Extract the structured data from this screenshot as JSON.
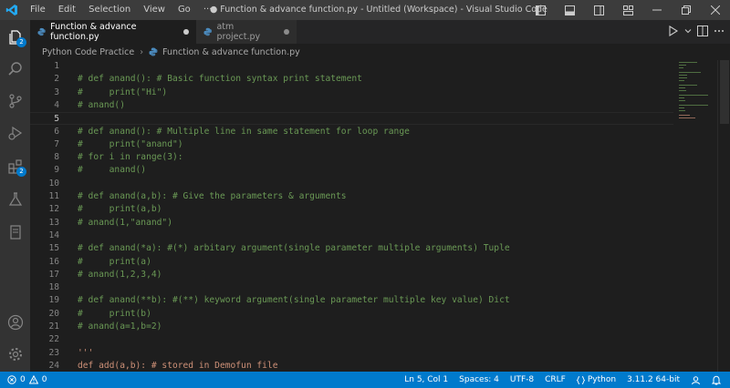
{
  "window": {
    "title": "● Function & advance function.py - Untitled (Workspace) - Visual Studio Code",
    "menu": [
      "File",
      "Edit",
      "Selection",
      "View",
      "Go",
      "···"
    ]
  },
  "activity_bar": {
    "explorer_badge": "2",
    "extensions_badge": "2"
  },
  "tabs": [
    {
      "label": "Function & advance function.py",
      "active": true,
      "modified": true
    },
    {
      "label": "atm project.py",
      "active": false,
      "modified": true
    }
  ],
  "breadcrumb": {
    "folder": "Python Code Practice",
    "file": "Function & advance function.py"
  },
  "editor": {
    "current_line": 5,
    "lines": [
      {
        "num": "1",
        "text": "",
        "kind": "plain"
      },
      {
        "num": "2",
        "text": "# def anand(): # Basic function syntax print statement",
        "kind": "comment"
      },
      {
        "num": "3",
        "text": "#     print(\"Hi\")",
        "kind": "comment"
      },
      {
        "num": "4",
        "text": "# anand()",
        "kind": "comment"
      },
      {
        "num": "5",
        "text": "",
        "kind": "plain"
      },
      {
        "num": "6",
        "text": "# def anand(): # Multiple line in same statement for loop range",
        "kind": "comment"
      },
      {
        "num": "7",
        "text": "#     print(\"anand\")",
        "kind": "comment"
      },
      {
        "num": "8",
        "text": "# for i in range(3):",
        "kind": "comment"
      },
      {
        "num": "9",
        "text": "#     anand()",
        "kind": "comment"
      },
      {
        "num": "10",
        "text": "",
        "kind": "plain"
      },
      {
        "num": "11",
        "text": "# def anand(a,b): # Give the parameters & arguments",
        "kind": "comment"
      },
      {
        "num": "12",
        "text": "#     print(a,b)",
        "kind": "comment"
      },
      {
        "num": "13",
        "text": "# anand(1,\"anand\")",
        "kind": "comment"
      },
      {
        "num": "14",
        "text": "",
        "kind": "plain"
      },
      {
        "num": "15",
        "text": "# def anand(*a): #(*) arbitary argument(single parameter multiple arguments) Tuple",
        "kind": "comment"
      },
      {
        "num": "16",
        "text": "#     print(a)",
        "kind": "comment"
      },
      {
        "num": "17",
        "text": "# anand(1,2,3,4)",
        "kind": "comment"
      },
      {
        "num": "18",
        "text": "",
        "kind": "plain"
      },
      {
        "num": "19",
        "text": "# def anand(**b): #(**) keyword argument(single parameter multiple key value) Dict",
        "kind": "comment"
      },
      {
        "num": "20",
        "text": "#     print(b)",
        "kind": "comment"
      },
      {
        "num": "21",
        "text": "# anand(a=1,b=2)",
        "kind": "comment"
      },
      {
        "num": "22",
        "text": "",
        "kind": "plain"
      },
      {
        "num": "23",
        "text": "'''",
        "kind": "string"
      },
      {
        "num": "24",
        "text": "def add(a,b): # stored in Demofun file",
        "kind": "string"
      }
    ]
  },
  "status_bar": {
    "errors": "0",
    "warnings": "0",
    "cursor": "Ln 5, Col 1",
    "spaces": "Spaces: 4",
    "encoding": "UTF-8",
    "eol": "CRLF",
    "language": "Python",
    "interpreter": "3.11.2 64-bit"
  },
  "colors": {
    "accent": "#007acc",
    "comment": "#6a9955",
    "string": "#ce9178",
    "logo": "#23a9f2"
  },
  "icons": [
    "vscode-logo-icon",
    "files-icon",
    "search-icon",
    "source-control-icon",
    "run-debug-icon",
    "extensions-icon",
    "testing-icon",
    "notebook-icon",
    "account-icon",
    "settings-gear-icon",
    "run-icon",
    "split-editor-icon",
    "more-icon",
    "python-file-icon",
    "error-icon",
    "warning-icon",
    "feedback-icon",
    "bell-icon"
  ]
}
